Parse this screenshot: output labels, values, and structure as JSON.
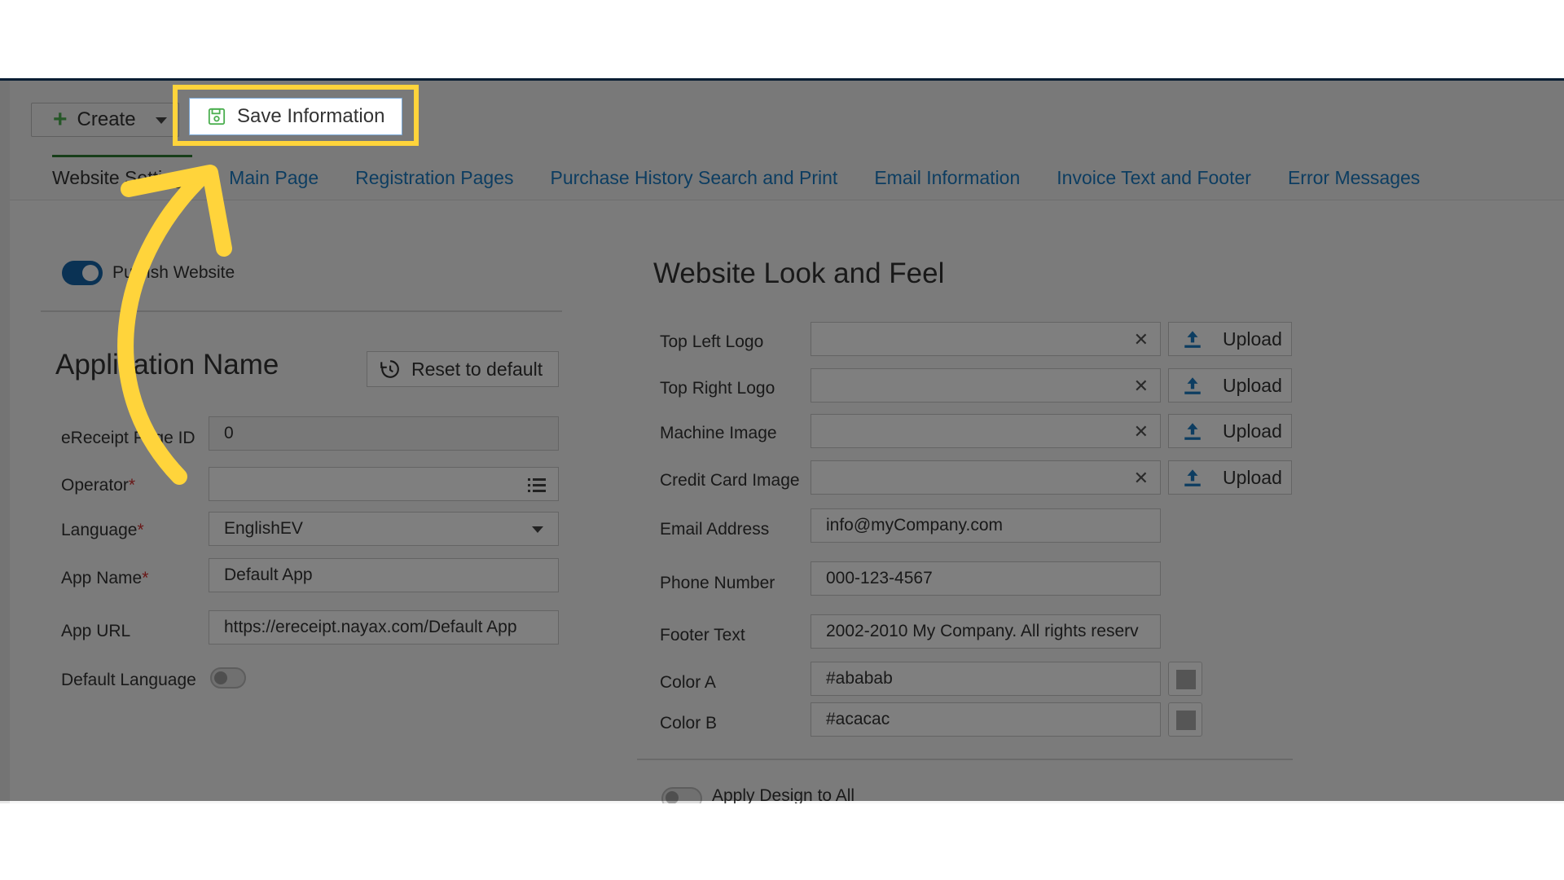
{
  "toolbar": {
    "create_label": "Create",
    "save_label": "Save Information"
  },
  "tabs": [
    {
      "label": "Website Settings"
    },
    {
      "label": "Main Page"
    },
    {
      "label": "Registration Pages"
    },
    {
      "label": "Purchase History Search and Print"
    },
    {
      "label": "Email Information"
    },
    {
      "label": "Invoice Text and Footer"
    },
    {
      "label": "Error Messages"
    }
  ],
  "left": {
    "publish_label": "Publish Website",
    "publish_on": true,
    "section_title": "Application Name",
    "reset_label": "Reset to default",
    "fields": {
      "ereceipt_label": "eReceipt Page ID",
      "ereceipt_value": "0",
      "operator_label": "Operator",
      "operator_value": "",
      "language_label": "Language",
      "language_value": "EnglishEV",
      "app_name_label": "App Name",
      "app_name_value": "Default App",
      "app_url_label": "App URL",
      "app_url_value": "https://ereceipt.nayax.com/Default App",
      "default_language_label": "Default Language",
      "required_mark": "*"
    },
    "default_language_on": false
  },
  "right": {
    "section_title": "Website Look and Feel",
    "logos": [
      {
        "label": "Top Left Logo",
        "value": "",
        "upload_label": "Upload"
      },
      {
        "label": "Top Right Logo",
        "value": "",
        "upload_label": "Upload"
      },
      {
        "label": "Machine Image",
        "value": "",
        "upload_label": "Upload"
      },
      {
        "label": "Credit Card Image",
        "value": "",
        "upload_label": "Upload"
      }
    ],
    "email_label": "Email Address",
    "email_value": "info@myCompany.com",
    "phone_label": "Phone Number",
    "phone_value": "000-123-4567",
    "footer_label": "Footer Text",
    "footer_value": "2002-2010 My Company. All rights reserv",
    "color_a_label": "Color A",
    "color_a_value": "#ababab",
    "color_b_label": "Color B",
    "color_b_value": "#acacac",
    "apply_label": "Apply Design to All",
    "apply_on": false
  },
  "colors": {
    "highlight": "#ffd43b",
    "arrow": "#ffd43b",
    "link": "#1a7bc2",
    "toggle_on": "#1565a8",
    "tab_active_border": "#2e7d32"
  }
}
